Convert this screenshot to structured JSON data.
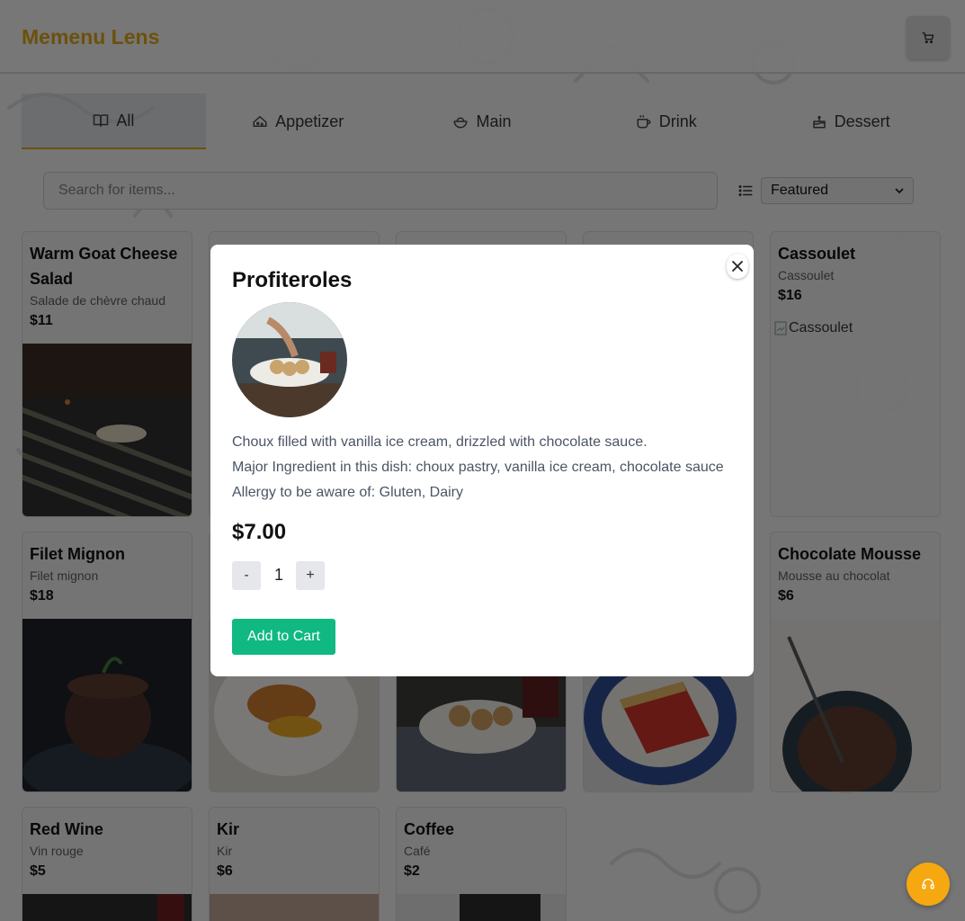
{
  "header": {
    "brand": "Memenu Lens",
    "cart_icon": "cart-icon"
  },
  "tabs": [
    {
      "label": "All",
      "icon": "book-open-icon",
      "active": true
    },
    {
      "label": "Appetizer",
      "icon": "cheese-icon",
      "active": false
    },
    {
      "label": "Main",
      "icon": "bowl-icon",
      "active": false
    },
    {
      "label": "Drink",
      "icon": "cup-icon",
      "active": false
    },
    {
      "label": "Dessert",
      "icon": "cake-icon",
      "active": false
    }
  ],
  "search": {
    "placeholder": "Search for items..."
  },
  "sort": {
    "selected": "Featured"
  },
  "items": [
    {
      "name": "Warm Goat Cheese Salad",
      "french": "Salade de chèvre chaud",
      "price": "$11"
    },
    {
      "name": "Cassoulet",
      "french": "Cassoulet",
      "price": "$16",
      "broken_image_alt": "Cassoulet"
    },
    {
      "name": "Filet Mignon",
      "french": "Filet mignon",
      "price": "$18"
    },
    {
      "name": "Chocolate Mousse",
      "french": "Mousse au chocolat",
      "price": "$6"
    },
    {
      "name": "Red Wine",
      "french": "Vin rouge",
      "price": "$5"
    },
    {
      "name": "Kir",
      "french": "Kir",
      "price": "$6"
    },
    {
      "name": "Coffee",
      "french": "Café",
      "price": "$2"
    }
  ],
  "modal": {
    "title": "Profiteroles",
    "description": "Choux filled with vanilla ice cream, drizzled with chocolate sauce.",
    "ingredients": "Major Ingredient in this dish: choux pastry, vanilla ice cream, chocolate sauce",
    "allergy": "Allergy to be aware of: Gluten, Dairy",
    "price": "$7.00",
    "minus": "-",
    "quantity": "1",
    "plus": "+",
    "add_label": "Add to Cart"
  },
  "colors": {
    "brand": "#d9a21a",
    "add_button": "#10b981",
    "chat_button": "#f5a80f"
  }
}
